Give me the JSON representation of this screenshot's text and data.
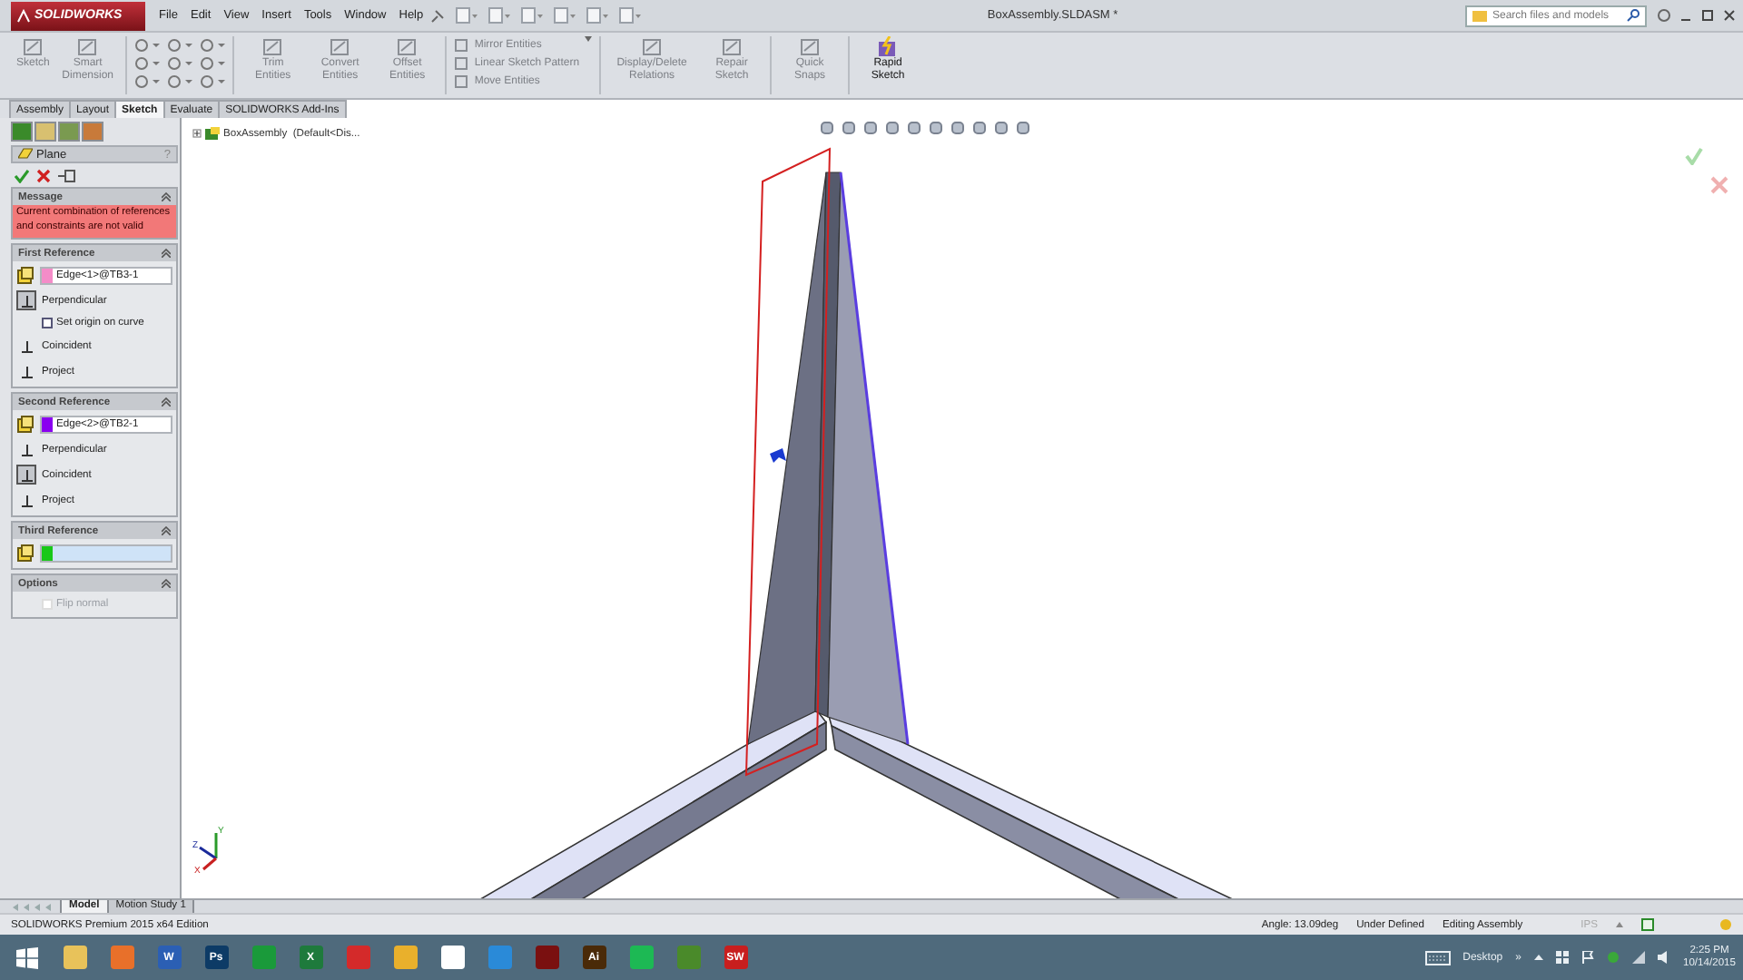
{
  "app": {
    "logo": "SOLIDWORKS",
    "menu": [
      "File",
      "Edit",
      "View",
      "Insert",
      "Tools",
      "Window",
      "Help"
    ],
    "title": "BoxAssembly.SLDASM *",
    "search": {
      "placeholder": "Search files and models"
    }
  },
  "ribbon": {
    "groups": [
      {
        "kind": "large",
        "items": [
          {
            "label": "Sketch",
            "disabled": true
          },
          {
            "label": "Smart Dimension",
            "disabled": true
          }
        ]
      },
      {
        "kind": "icon_grid"
      },
      {
        "kind": "large",
        "items": [
          {
            "label": "Trim Entities",
            "disabled": true
          },
          {
            "label": "Convert Entities",
            "disabled": true
          },
          {
            "label": "Offset Entities",
            "disabled": true
          }
        ]
      },
      {
        "kind": "small_list",
        "items": [
          {
            "label": "Mirror Entities",
            "disabled": true
          },
          {
            "label": "Linear Sketch Pattern",
            "disabled": true
          },
          {
            "label": "Move Entities",
            "disabled": true
          }
        ]
      },
      {
        "kind": "large",
        "items": [
          {
            "label": "Display/Delete Relations",
            "disabled": true
          },
          {
            "label": "Repair Sketch",
            "disabled": true
          }
        ]
      },
      {
        "kind": "large",
        "items": [
          {
            "label": "Quick Snaps",
            "disabled": true
          }
        ]
      },
      {
        "kind": "large",
        "items": [
          {
            "label": "Rapid Sketch",
            "disabled": false
          }
        ]
      }
    ]
  },
  "command_tabs": [
    {
      "label": "Assembly",
      "selected": false
    },
    {
      "label": "Layout",
      "selected": false
    },
    {
      "label": "Sketch",
      "selected": true
    },
    {
      "label": "Evaluate",
      "selected": false
    },
    {
      "label": "SOLIDWORKS Add-Ins",
      "selected": false
    }
  ],
  "property_manager": {
    "title": "Plane",
    "help": "?",
    "sections": [
      {
        "kind": "message",
        "title": "Message",
        "text": "Current combination of references and constraints are not valid"
      },
      {
        "kind": "reference",
        "title": "First Reference",
        "field": {
          "value": "Edge<1>@TB3-1",
          "color": "#f48cc8",
          "active": false
        },
        "options": [
          {
            "kind": "toggle",
            "label": "Perpendicular",
            "selected": true
          },
          {
            "kind": "checkbox",
            "label": "Set origin on curve",
            "checked": false,
            "disabled": false
          },
          {
            "kind": "toggle",
            "label": "Coincident",
            "selected": false
          },
          {
            "kind": "toggle",
            "label": "Project",
            "selected": false
          }
        ]
      },
      {
        "kind": "reference",
        "title": "Second Reference",
        "field": {
          "value": "Edge<2>@TB2-1",
          "color": "#8a00f0",
          "active": false
        },
        "options": [
          {
            "kind": "toggle",
            "label": "Perpendicular",
            "selected": false
          },
          {
            "kind": "toggle",
            "label": "Coincident",
            "selected": true
          },
          {
            "kind": "toggle",
            "label": "Project",
            "selected": false
          }
        ]
      },
      {
        "kind": "reference",
        "title": "Third Reference",
        "field": {
          "color": "#18c818",
          "active": true
        }
      },
      {
        "kind": "options",
        "title": "Options",
        "options": [
          {
            "kind": "checkbox",
            "label": "Flip normal",
            "checked": false,
            "disabled": true
          }
        ]
      }
    ]
  },
  "feature_tree": {
    "label": "BoxAssembly  (Default<Dis..."
  },
  "triad": {
    "labels": [
      "Y",
      "Z",
      "X"
    ]
  },
  "model_tabs": [
    {
      "label": "Model",
      "selected": true
    },
    {
      "label": "Motion Study 1",
      "selected": false
    }
  ],
  "status_bar": {
    "edition": "SOLIDWORKS Premium 2015 x64 Edition",
    "angle": "Angle: 13.09deg",
    "state": "Under Defined",
    "mode": "Editing Assembly",
    "units": "IPS"
  },
  "taskbar": {
    "apps": [
      {
        "color": "#e8c25a"
      },
      {
        "color": "#e8702a"
      },
      {
        "color": "#2b5fb4",
        "glyph": "W"
      },
      {
        "color": "#0d3b66",
        "glyph": "Ps"
      },
      {
        "color": "#1a9a3a"
      },
      {
        "color": "#1e7a3c",
        "glyph": "X"
      },
      {
        "color": "#d42a2a"
      },
      {
        "color": "#e9b02c"
      },
      {
        "color": "#ffffff"
      },
      {
        "color": "#2a8ad8"
      },
      {
        "color": "#7a1010"
      },
      {
        "color": "#4a2a08",
        "glyph": "Ai"
      },
      {
        "color": "#1db954"
      },
      {
        "color": "#4a8a2a"
      },
      {
        "color": "#c81e1e",
        "glyph": "SW"
      }
    ],
    "desktop": "Desktop",
    "more": "»",
    "time": "2:25 PM",
    "date": "10/14/2015"
  }
}
